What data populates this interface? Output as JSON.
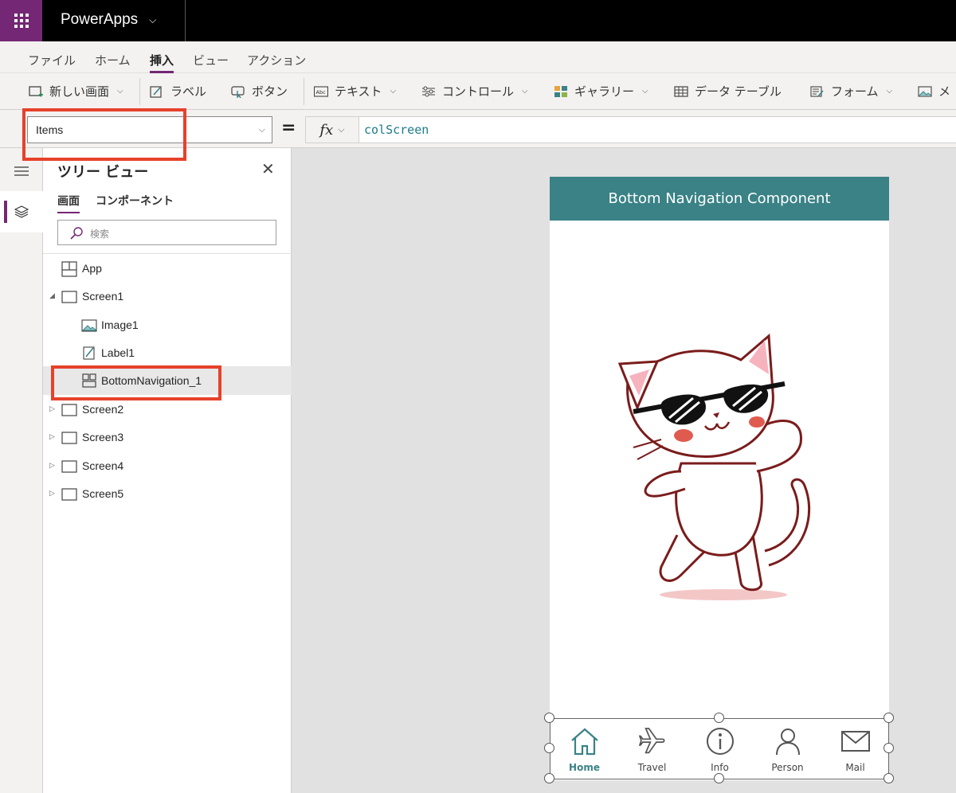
{
  "app": {
    "name": "PowerApps"
  },
  "menu": {
    "tabs": [
      {
        "label": "ファイル",
        "active": false
      },
      {
        "label": "ホーム",
        "active": false
      },
      {
        "label": "挿入",
        "active": true
      },
      {
        "label": "ビュー",
        "active": false
      },
      {
        "label": "アクション",
        "active": false
      }
    ]
  },
  "ribbon": {
    "new_screen": "新しい画面",
    "label": "ラベル",
    "button": "ボタン",
    "text": "テキスト",
    "controls": "コントロール",
    "gallery": "ギャラリー",
    "data_table": "データ テーブル",
    "form": "フォーム",
    "media": "メ"
  },
  "formula_bar": {
    "property": "Items",
    "fx": "fx",
    "formula": "colScreen"
  },
  "tree_view": {
    "title": "ツリー ビュー",
    "tabs": [
      "画面",
      "コンポーネント"
    ],
    "search_placeholder": "検索",
    "nodes": [
      "App",
      "Screen1",
      "Image1",
      "Label1",
      "BottomNavigation_1",
      "Screen2",
      "Screen3",
      "Screen4",
      "Screen5"
    ]
  },
  "canvas": {
    "header_title": "Bottom Navigation Component",
    "nav_items": [
      {
        "label": "Home",
        "icon": "home-icon",
        "active": true
      },
      {
        "label": "Travel",
        "icon": "airplane-icon",
        "active": false
      },
      {
        "label": "Info",
        "icon": "info-icon",
        "active": false
      },
      {
        "label": "Person",
        "icon": "person-icon",
        "active": false
      },
      {
        "label": "Mail",
        "icon": "mail-icon",
        "active": false
      }
    ]
  },
  "colors": {
    "brand": "#742774",
    "header": "#3a8286",
    "highlight": "#e6412b"
  }
}
